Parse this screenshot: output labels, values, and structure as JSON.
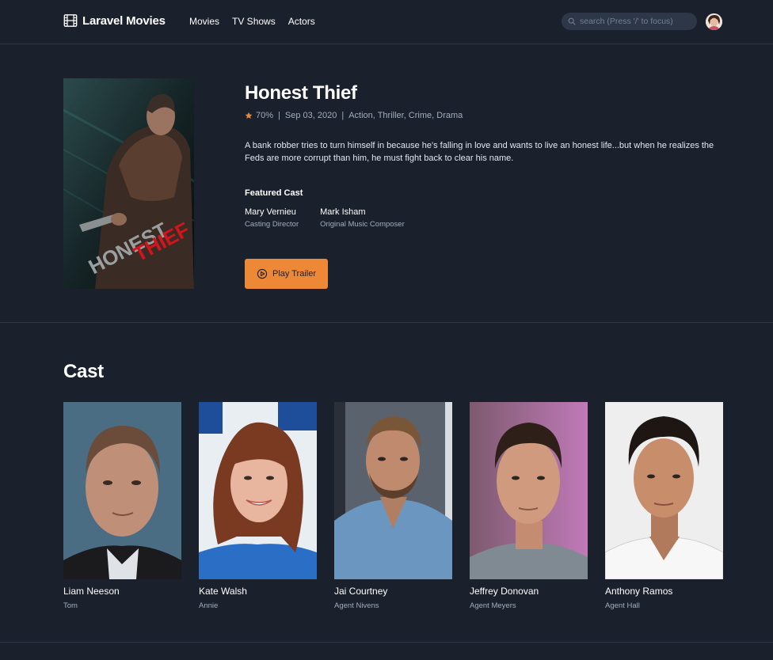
{
  "nav": {
    "logo": "Laravel Movies",
    "links": [
      "Movies",
      "TV Shows",
      "Actors"
    ],
    "search_placeholder": "search (Press '/' to focus)"
  },
  "movie": {
    "title": "Honest Thief",
    "rating": "70%",
    "release_date": "Sep 03, 2020",
    "genres": "Action, Thriller, Crime, Drama",
    "separator": "|",
    "overview": "A bank robber tries to turn himself in because he's falling in love and wants to live an honest life...but when he realizes the Feds are more corrupt than him, he must fight back to clear his name.",
    "featured_cast_title": "Featured Cast",
    "crew": [
      {
        "name": "Mary Vernieu",
        "job": "Casting Director"
      },
      {
        "name": "Mark Isham",
        "job": "Original Music Composer"
      }
    ],
    "trailer_label": "Play Trailer",
    "poster_text": [
      "HONEST",
      "THIEF"
    ]
  },
  "cast": {
    "heading": "Cast",
    "members": [
      {
        "name": "Liam Neeson",
        "character": "Tom"
      },
      {
        "name": "Kate Walsh",
        "character": "Annie"
      },
      {
        "name": "Jai Courtney",
        "character": "Agent Nivens"
      },
      {
        "name": "Jeffrey Donovan",
        "character": "Agent Meyers"
      },
      {
        "name": "Anthony Ramos",
        "character": "Agent Hall"
      }
    ]
  },
  "colors": {
    "background": "#1a202c",
    "accent": "#ed8936",
    "muted_text": "#a0aec0",
    "border": "#2d3748"
  },
  "icons": [
    "film-icon",
    "search-icon",
    "star-icon",
    "play-circle-icon"
  ]
}
